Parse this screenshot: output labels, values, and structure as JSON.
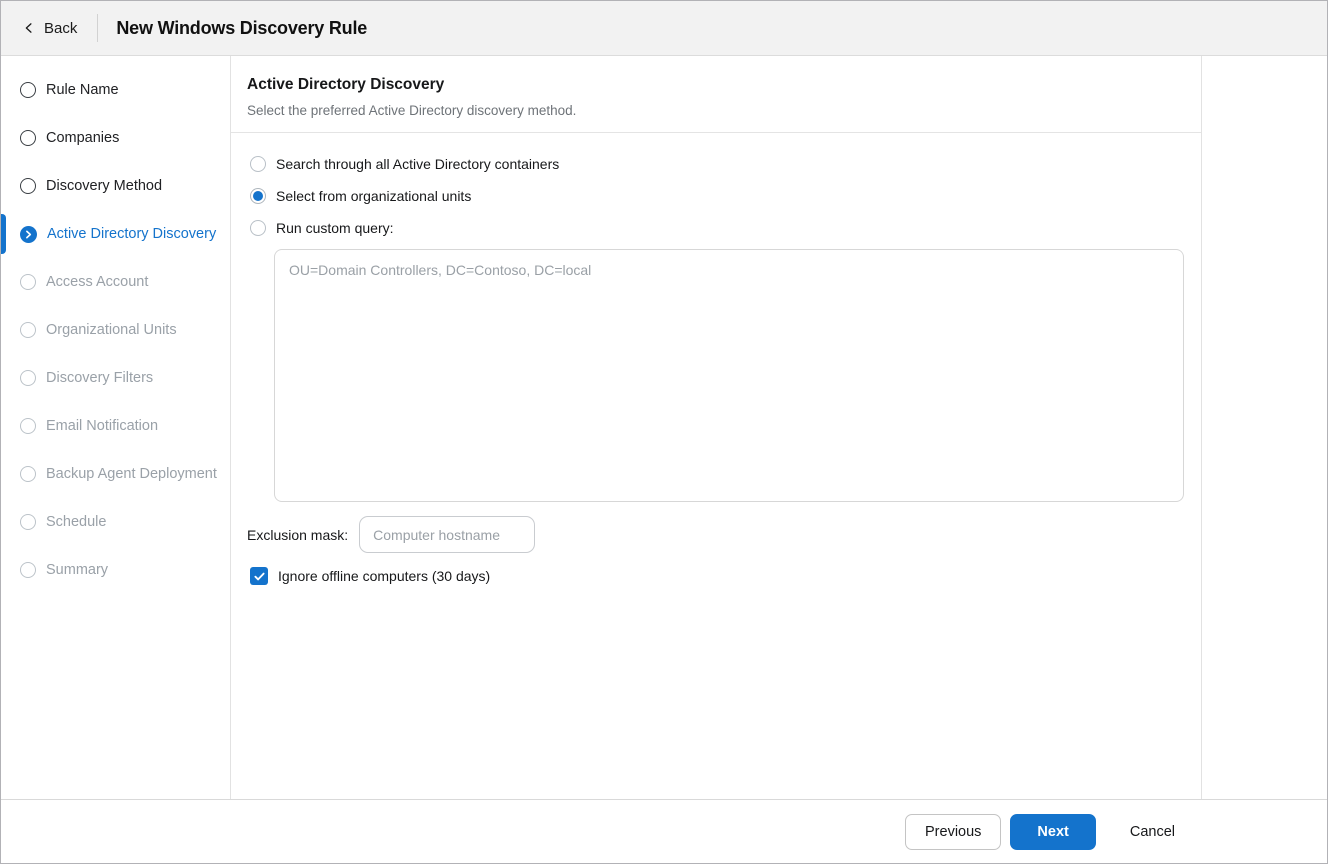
{
  "header": {
    "back_label": "Back",
    "title": "New Windows Discovery Rule"
  },
  "sidebar": {
    "steps": [
      {
        "label": "Rule Name",
        "state": "done"
      },
      {
        "label": "Companies",
        "state": "done"
      },
      {
        "label": "Discovery Method",
        "state": "done"
      },
      {
        "label": "Active Directory Discovery",
        "state": "active"
      },
      {
        "label": "Access Account",
        "state": "pending"
      },
      {
        "label": "Organizational Units",
        "state": "pending"
      },
      {
        "label": "Discovery Filters",
        "state": "pending"
      },
      {
        "label": "Email Notification",
        "state": "pending"
      },
      {
        "label": "Backup Agent Deployment",
        "state": "pending"
      },
      {
        "label": "Schedule",
        "state": "pending"
      },
      {
        "label": "Summary",
        "state": "pending"
      }
    ]
  },
  "main": {
    "section_title": "Active Directory Discovery",
    "section_subtitle": "Select the preferred Active Directory discovery method.",
    "radios": [
      {
        "label": "Search through all Active Directory containers",
        "selected": false
      },
      {
        "label": "Select from organizational units",
        "selected": true
      },
      {
        "label": "Run custom query:",
        "selected": false
      }
    ],
    "query_textarea": {
      "value": "",
      "placeholder": "OU=Domain Controllers, DC=Contoso, DC=local"
    },
    "exclusion_mask": {
      "label": "Exclusion mask:",
      "value": "",
      "placeholder": "Computer hostname"
    },
    "ignore_offline": {
      "label": "Ignore offline computers (30 days)",
      "checked": true
    }
  },
  "footer": {
    "previous_label": "Previous",
    "next_label": "Next",
    "cancel_label": "Cancel"
  },
  "colors": {
    "accent_blue": "#1473cc",
    "header_bg": "#f2f2f2",
    "border_gray": "#e2e2e2",
    "text_dark": "#17181a",
    "text_pending_gray": "#9aa1a8",
    "subtitle_gray": "#6e7378",
    "placeholder_gray": "#9aa0a6"
  }
}
